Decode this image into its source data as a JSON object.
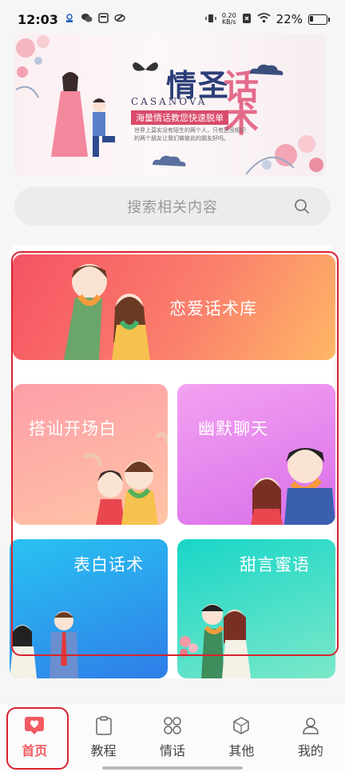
{
  "status_bar": {
    "time": "12:03",
    "net_speed_value": "0.20",
    "net_speed_unit": "KB/s",
    "battery": "22%",
    "battery_level": 0.22
  },
  "banner": {
    "title_main": "情圣",
    "title_accent": "话术",
    "subtitle_en": "CASANOVA",
    "slogan": "海量情话教您快速脱单",
    "description": "世界上莫实没有陌生的两个人，只有还没相识的两个朋友让我们做彼此的朋友好吗。"
  },
  "search": {
    "placeholder": "搜索相关内容"
  },
  "cards": [
    {
      "label": "恋爱话术库"
    },
    {
      "label": "搭讪开场白"
    },
    {
      "label": "幽默聊天"
    },
    {
      "label": "表白话术"
    },
    {
      "label": "甜言蜜语"
    }
  ],
  "tabs": [
    {
      "label": "首页",
      "icon": "heart-home-icon"
    },
    {
      "label": "教程",
      "icon": "clipboard-icon"
    },
    {
      "label": "情话",
      "icon": "grid-icon"
    },
    {
      "label": "其他",
      "icon": "cube-icon"
    },
    {
      "label": "我的",
      "icon": "user-icon"
    }
  ],
  "colors": {
    "accent": "#f25a62",
    "highlight": "#d9232e"
  }
}
